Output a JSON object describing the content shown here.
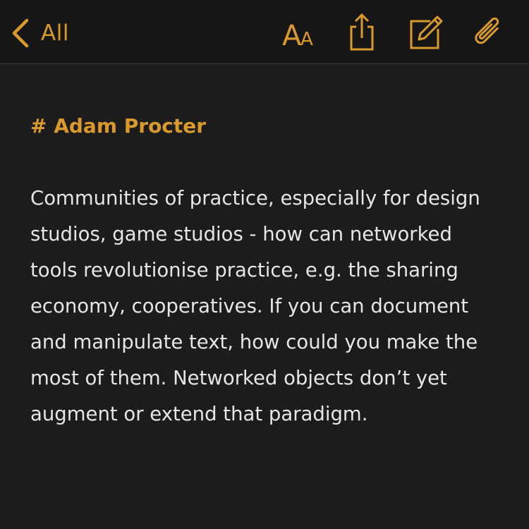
{
  "nav": {
    "back_label": "All",
    "back_icon": "chevron-left-icon",
    "tools": [
      {
        "icon": "text-format-icon",
        "glyph_large": "A",
        "glyph_small": "A"
      },
      {
        "icon": "share-icon"
      },
      {
        "icon": "compose-icon"
      },
      {
        "icon": "paperclip-icon"
      }
    ]
  },
  "note": {
    "heading": "# Adam Procter",
    "body": "Communities of practice, especially for design studios, game studios - how can networked tools revolutionise practice, e.g. the sharing economy, cooperatives. If you can document and manipulate text, how could you make the most of them. Networked objects don’t yet augment or extend that paradigm."
  },
  "colors": {
    "accent": "#d99a2b",
    "background": "#1c1c1c",
    "nav_background": "#161616",
    "text": "#e6e6e6"
  }
}
